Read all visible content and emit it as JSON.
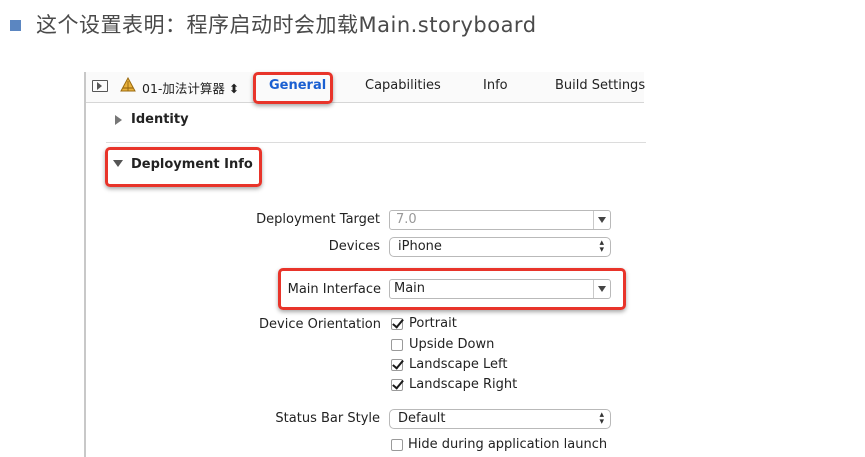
{
  "slide": {
    "title": "这个设置表明：程序启动时会加载Main.storyboard"
  },
  "toolbar": {
    "target_name": "01-加法计算器 ⬍",
    "tabs": [
      "General",
      "Capabilities",
      "Info",
      "Build Settings"
    ]
  },
  "sections": {
    "identity": "Identity",
    "deployment": "Deployment Info"
  },
  "deployment": {
    "target_label": "Deployment Target",
    "target_value": "7.0",
    "devices_label": "Devices",
    "devices_value": "iPhone",
    "main_interface_label": "Main Interface",
    "main_interface_value": "Main",
    "orientation_label": "Device Orientation",
    "orientations": [
      {
        "label": "Portrait",
        "checked": true
      },
      {
        "label": "Upside Down",
        "checked": false
      },
      {
        "label": "Landscape Left",
        "checked": true
      },
      {
        "label": "Landscape Right",
        "checked": true
      }
    ],
    "status_bar_label": "Status Bar Style",
    "status_bar_value": "Default",
    "hide_status_label": "Hide during application launch",
    "hide_status_checked": false
  },
  "colors": {
    "highlight": "#e8342a",
    "selected_tab": "#1a5fd1",
    "bullet": "#5b86c1"
  }
}
